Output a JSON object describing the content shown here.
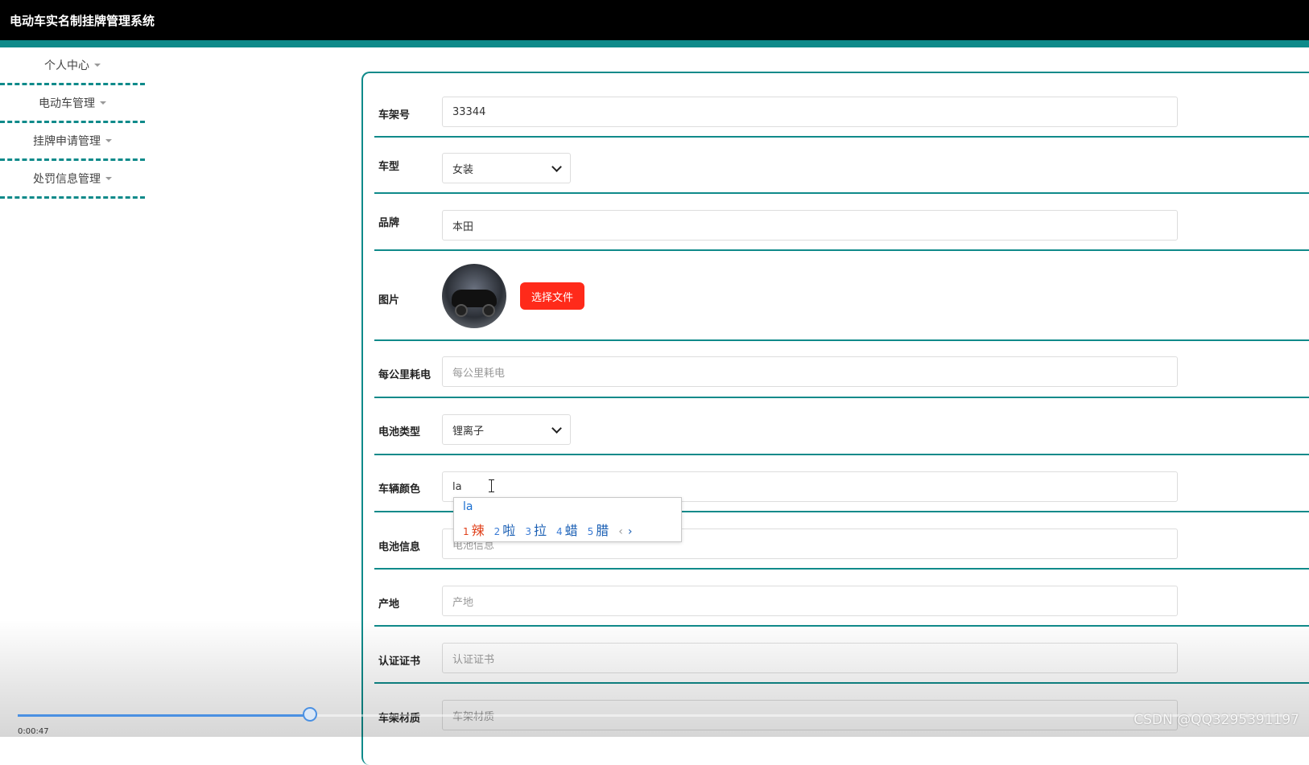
{
  "app": {
    "title": "电动车实名制挂牌管理系统"
  },
  "sidebar": {
    "items": [
      {
        "label": "个人中心"
      },
      {
        "label": "电动车管理"
      },
      {
        "label": "挂牌申请管理"
      },
      {
        "label": "处罚信息管理"
      }
    ]
  },
  "form": {
    "frame_no": {
      "label": "车架号",
      "value": "33344"
    },
    "vehicle_type": {
      "label": "车型",
      "value": "女装"
    },
    "brand": {
      "label": "品牌",
      "value": "本田"
    },
    "image": {
      "label": "图片",
      "button": "选择文件"
    },
    "power_per_km": {
      "label": "每公里耗电",
      "placeholder": "每公里耗电"
    },
    "battery_type": {
      "label": "电池类型",
      "value": "锂离子"
    },
    "color": {
      "label": "车辆颜色",
      "value": "la"
    },
    "battery_info": {
      "label": "电池信息",
      "placeholder": "电池信息"
    },
    "origin": {
      "label": "产地",
      "placeholder": "产地"
    },
    "certificate": {
      "label": "认证证书",
      "placeholder": "认证证书"
    },
    "frame_material": {
      "label": "车架材质",
      "placeholder": "车架材质"
    }
  },
  "ime": {
    "composition": "la",
    "candidates": [
      {
        "num": "1",
        "text": "辣"
      },
      {
        "num": "2",
        "text": "啦"
      },
      {
        "num": "3",
        "text": "拉"
      },
      {
        "num": "4",
        "text": "蜡"
      },
      {
        "num": "5",
        "text": "腊"
      }
    ],
    "prev": "‹",
    "next": "›"
  },
  "video": {
    "time": "0:00:47",
    "progress": 0.23
  },
  "watermark": "CSDN @QQ3295391197",
  "colors": {
    "accent": "#0f8a8a",
    "file_button": "#ff2a1a",
    "topbar": "#000000"
  }
}
